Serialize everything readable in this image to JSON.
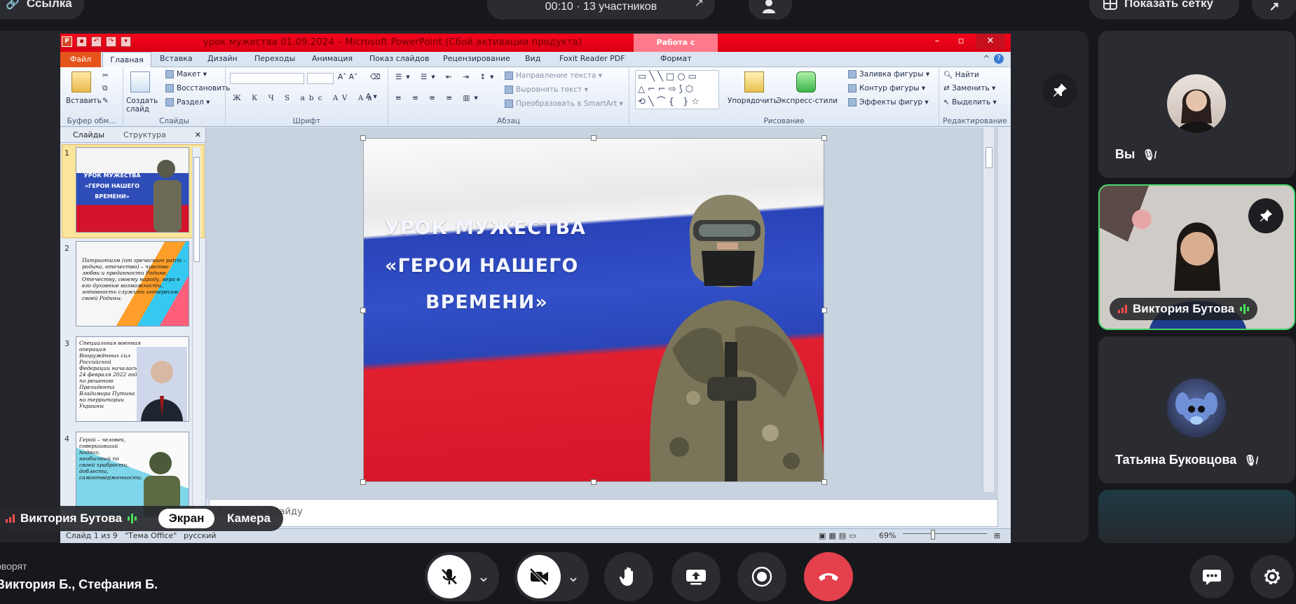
{
  "topbar": {
    "link_label": "Ссылка",
    "timer_text": "00:10 · 13 участников",
    "grid_label": "Показать сетку"
  },
  "ppt": {
    "title": "урок мужества 01.09.2024 – Microsoft PowerPoint (Сбой активации продукта)",
    "context_tab": "Работа с рисунками",
    "tabs": {
      "file": "Файл",
      "home": "Главная",
      "insert": "Вставка",
      "design": "Дизайн",
      "transitions": "Переходы",
      "animation": "Анимация",
      "slideshow": "Показ слайдов",
      "review": "Рецензирование",
      "view": "Вид",
      "foxit": "Foxit Reader PDF",
      "format": "Формат"
    },
    "ribbon": {
      "paste": "Вставить",
      "clipboard_group": "Буфер обм...",
      "layout": "Макет",
      "reset": "Восстановить",
      "section": "Раздел",
      "new_slide": "Создать слайд",
      "slides_group": "Слайды",
      "font_group": "Шрифт",
      "text_direction": "Направление текста",
      "align_text": "Выровнять текст",
      "smartart": "Преобразовать в SmartArt",
      "paragraph_group": "Абзац",
      "arrange": "Упорядочить",
      "quick_styles": "Экспресс-стили",
      "shape_fill": "Заливка фигуры",
      "shape_outline": "Контур фигуры",
      "shape_effects": "Эффекты фигур",
      "drawing_group": "Рисование",
      "find": "Найти",
      "replace": "Заменить",
      "select": "Выделить",
      "editing_group": "Редактирование"
    },
    "panel": {
      "tab_slides": "Слайды",
      "tab_outline": "Структура",
      "thumbs": [
        {
          "num": "1",
          "text": "УРОК МУЖЕСТВА «ГЕРОИ НАШЕГО ВРЕМЕНИ»"
        },
        {
          "num": "2",
          "text": "Патриотизм (от греческого patris – родина, отечество) – чувство любви и преданности Родине, Отечеству, своему народу, вера в его духовные возможности, готовность служить интересам своей Родины."
        },
        {
          "num": "3",
          "text": "Специальная военная операция Вооружённых сил Российской Федерации началась 24 февраля 2022 года по решению Президента Владимира Путина на территории Украины"
        },
        {
          "num": "4",
          "text": "Герой – человек, совершивший подвиг, необычный по своей храбрости, доблести, самоотверженности."
        }
      ]
    },
    "slide": {
      "line1": "УРОК МУЖЕСТВА",
      "line2": "«ГЕРОИ НАШЕГО",
      "line3": "ВРЕМЕНИ»"
    },
    "notes_placeholder": "Заметки к слайду",
    "status": {
      "slide_of": "Слайд 1 из 9",
      "theme": "\"Тема Office\"",
      "language": "русский",
      "zoom": "69%"
    }
  },
  "presenter": {
    "name": "Виктория Бутова",
    "screen_label": "Экран",
    "camera_label": "Камера"
  },
  "participants": [
    {
      "name": "Вы",
      "muted": true
    },
    {
      "name": "Виктория Бутова",
      "speaking": true
    },
    {
      "name": "Татьяна Буковцова",
      "muted": true
    }
  ],
  "bottom": {
    "speaking_label": "оворят",
    "speaking_names": "Виктория Б., Стефания Б."
  },
  "colors": {
    "speaking_green": "#48d66a",
    "end_call_red": "#e5414d",
    "ppt_title_red": "#e60018"
  }
}
